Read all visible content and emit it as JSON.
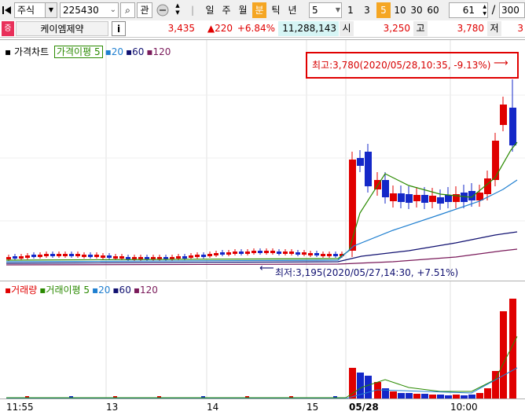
{
  "toolbar": {
    "market": "주식",
    "code": "225430",
    "search_btn": "⌕",
    "watch_btn": "관",
    "period_buttons": [
      {
        "label": "일",
        "active": false
      },
      {
        "label": "주",
        "active": false
      },
      {
        "label": "월",
        "active": false
      },
      {
        "label": "분",
        "active": true
      },
      {
        "label": "틱",
        "active": false
      },
      {
        "label": "년",
        "active": false
      }
    ],
    "interval_value": "5",
    "interval_buttons": [
      {
        "label": "1",
        "active": false
      },
      {
        "label": "3",
        "active": false
      },
      {
        "label": "5",
        "active": true
      },
      {
        "label": "10",
        "active": false
      },
      {
        "label": "30",
        "active": false
      },
      {
        "label": "60",
        "active": false
      }
    ],
    "count_value": "61",
    "count_sep": "/",
    "count_total": "300"
  },
  "info": {
    "badge": "증",
    "name": "케이엠제약",
    "info_btn": "i",
    "price": "3,435",
    "change": "▲220",
    "change_pct": "+6.84%",
    "volume": "11,288,143",
    "open_label": "시",
    "open": "3,250",
    "high_label": "고",
    "high": "3,780",
    "low_label": "저",
    "low": "3"
  },
  "colors": {
    "up": "#e00000",
    "down": "#1428c8",
    "ma5": "#2a8a00",
    "ma20": "#1f7fd0",
    "ma60": "#101070",
    "ma120": "#7a1a5a",
    "badge_bg": "#e8305a",
    "highlight": "#d70000"
  },
  "price_panel": {
    "title": "가격차트",
    "legend": [
      {
        "label": "가격이평 5",
        "color": "#2a8a00",
        "boxed": true
      },
      {
        "label": "20",
        "color": "#1f7fd0",
        "boxed": false
      },
      {
        "label": "60",
        "color": "#101070",
        "boxed": false
      },
      {
        "label": "120",
        "color": "#7a1a5a",
        "boxed": false
      }
    ],
    "high_note": "최고:3,780(2020/05/28,10:35, -9.13%)",
    "low_note": "최저:3,195(2020/05/27,14:30, +7.51%)"
  },
  "volume_panel": {
    "legend": [
      {
        "label": "거래량",
        "color": "#e00000"
      },
      {
        "label": "거래이평 5",
        "color": "#2a8a00"
      },
      {
        "label": "20",
        "color": "#1f7fd0"
      },
      {
        "label": "60",
        "color": "#101070"
      },
      {
        "label": "120",
        "color": "#7a1a5a"
      }
    ]
  },
  "x_axis_labels": [
    {
      "label": "11:55",
      "bold": false
    },
    {
      "label": "13",
      "bold": false
    },
    {
      "label": "14",
      "bold": false
    },
    {
      "label": "15",
      "bold": false
    },
    {
      "label": "05/28",
      "bold": true
    },
    {
      "label": "10:00",
      "bold": false
    }
  ]
}
